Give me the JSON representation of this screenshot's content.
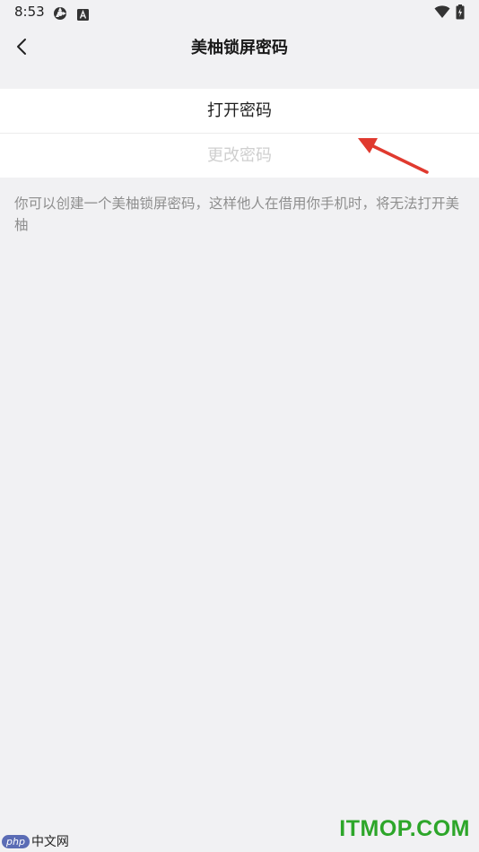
{
  "status_bar": {
    "time": "8:53",
    "icons": [
      "app-notification-icon",
      "a-badge-icon",
      "wifi-icon",
      "battery-icon"
    ]
  },
  "navbar": {
    "back_icon": "chevron-left-icon",
    "title": "美柚锁屏密码"
  },
  "options": [
    {
      "label": "打开密码",
      "enabled": true
    },
    {
      "label": "更改密码",
      "enabled": false
    }
  ],
  "help_text": "你可以创建一个美柚锁屏密码，这样他人在借用你手机时，将无法打开美柚",
  "annotation": {
    "color": "#e03a2f",
    "icon": "red-arrow-annotation"
  },
  "watermarks": {
    "left_badge": "php",
    "left_text": "中文网",
    "right_text": "ITMOP.COM"
  },
  "colors": {
    "background": "#f1f1f3",
    "enabled_text": "#1f1f1f",
    "disabled_text": "#cfcfcf",
    "help_text": "#8e8e8e",
    "watermark_green": "#2da62a"
  }
}
